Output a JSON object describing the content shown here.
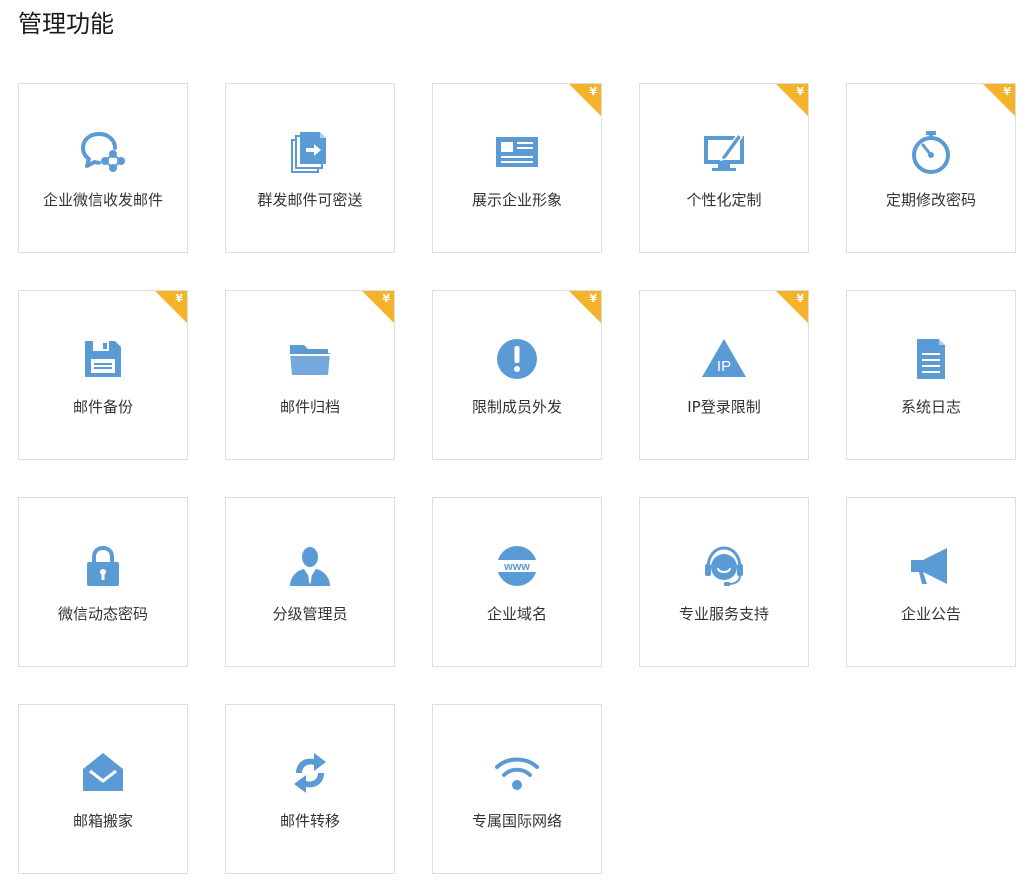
{
  "page": {
    "title": "管理功能"
  },
  "colors": {
    "icon": "#5b9bd5",
    "badge": "#f5b32c",
    "border": "#dedede"
  },
  "badge_symbol": "¥",
  "features": [
    {
      "label": "企业微信收发邮件",
      "icon": "wechat-bubble-icon",
      "paid": false
    },
    {
      "label": "群发邮件可密送",
      "icon": "mass-send-documents-icon",
      "paid": false
    },
    {
      "label": "展示企业形象",
      "icon": "business-card-icon",
      "paid": true
    },
    {
      "label": "个性化定制",
      "icon": "monitor-pen-icon",
      "paid": true
    },
    {
      "label": "定期修改密码",
      "icon": "stopwatch-icon",
      "paid": true
    },
    {
      "label": "邮件备份",
      "icon": "floppy-disk-icon",
      "paid": true
    },
    {
      "label": "邮件归档",
      "icon": "folder-icon",
      "paid": true
    },
    {
      "label": "限制成员外发",
      "icon": "exclamation-circle-icon",
      "paid": true
    },
    {
      "label": "IP登录限制",
      "icon": "ip-triangle-icon",
      "paid": true
    },
    {
      "label": "系统日志",
      "icon": "document-log-icon",
      "paid": false
    },
    {
      "label": "微信动态密码",
      "icon": "padlock-icon",
      "paid": false
    },
    {
      "label": "分级管理员",
      "icon": "admin-person-icon",
      "paid": false
    },
    {
      "label": "企业域名",
      "icon": "www-globe-icon",
      "paid": false
    },
    {
      "label": "专业服务支持",
      "icon": "headset-support-icon",
      "paid": false
    },
    {
      "label": "企业公告",
      "icon": "megaphone-icon",
      "paid": false
    },
    {
      "label": "邮箱搬家",
      "icon": "mailbox-move-icon",
      "paid": false
    },
    {
      "label": "邮件转移",
      "icon": "transfer-arrows-icon",
      "paid": false
    },
    {
      "label": "专属国际网络",
      "icon": "wifi-signal-icon",
      "paid": false
    }
  ]
}
